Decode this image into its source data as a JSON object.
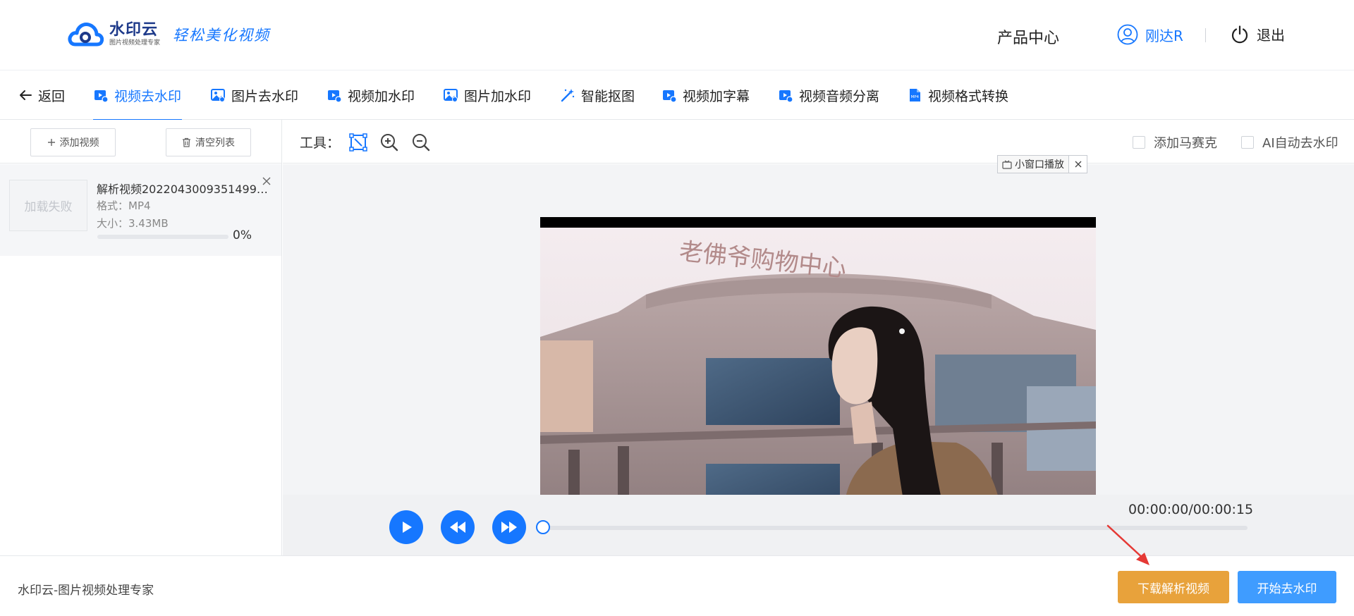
{
  "header": {
    "logo_name": "水印云",
    "logo_sub": "图片视频处理专家",
    "slogan": "轻松美化视频",
    "products_label": "产品中心",
    "user_name": "刚达R",
    "logout_label": "退出"
  },
  "tabs": {
    "back_label": "返回",
    "items": [
      {
        "label": "视频去水印",
        "icon": "video-icon",
        "active": true
      },
      {
        "label": "图片去水印",
        "icon": "image-icon"
      },
      {
        "label": "视频加水印",
        "icon": "video-icon"
      },
      {
        "label": "图片加水印",
        "icon": "image-icon"
      },
      {
        "label": "智能抠图",
        "icon": "magic-wand-icon"
      },
      {
        "label": "视频加字幕",
        "icon": "video-icon"
      },
      {
        "label": "视频音频分离",
        "icon": "video-icon"
      },
      {
        "label": "视频格式转换",
        "icon": "mp4-file-icon"
      }
    ]
  },
  "sidebar": {
    "add_video_label": "添加视频",
    "clear_list_label": "清空列表",
    "file": {
      "thumb_status": "加载失败",
      "name": "解析视频20220430093514996...",
      "format": "格式：MP4",
      "size": "大小：3.43MB",
      "progress": 0,
      "progress_text": "0%"
    }
  },
  "toolbar": {
    "label": "工具：",
    "mosaic_label": "添加马赛克",
    "ai_remove_label": "AI自动去水印",
    "mini_window_label": "小窗口播放"
  },
  "video": {
    "sign_text": "老佛爷购物中心"
  },
  "player": {
    "time": "00:00:00/00:00:15",
    "position": 0
  },
  "footer": {
    "brand_text": "水印云-图片视频处理专家",
    "download_label": "下载解析视频",
    "start_label": "开始去水印"
  },
  "colors": {
    "accent": "#1677ff",
    "download": "#e8a23b",
    "start": "#3f9cff",
    "annotation_arrow": "#e53935"
  }
}
